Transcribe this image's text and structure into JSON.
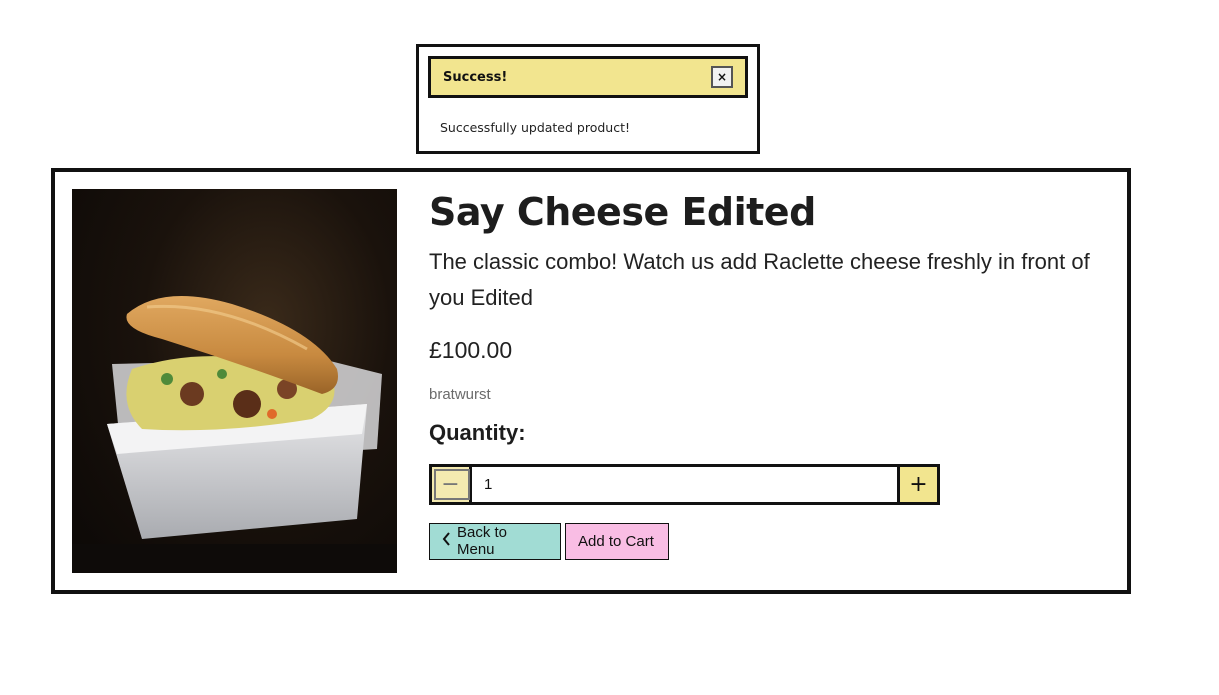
{
  "toast": {
    "title": "Success!",
    "close_label": "×",
    "message": "Successfully updated product!"
  },
  "product": {
    "title": "Say Cheese Edited",
    "description": "The classic combo! Watch us add Raclette cheese freshly in front of you Edited",
    "price": "£100.00",
    "category": "bratwurst",
    "image_alt": "sandwich-photo"
  },
  "quantity": {
    "label": "Quantity:",
    "value": "1",
    "decrement_label": "−",
    "increment_label": "+"
  },
  "actions": {
    "back_label": "Back to Menu",
    "back_icon": "chevron-left-icon",
    "cart_label": "Add to Cart"
  },
  "colors": {
    "toast_header": "#f2e58f",
    "back_button": "#a1dcd4",
    "cart_button": "#f9bde4",
    "qty_button": "#f2e58f"
  }
}
